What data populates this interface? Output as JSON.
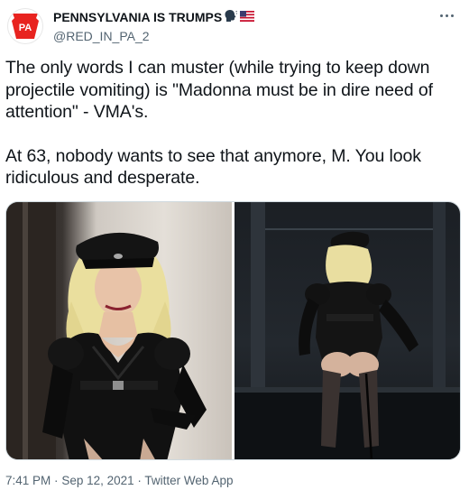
{
  "author": {
    "name": "PENNSYLVANIA IS TRUMPS",
    "handle": "@RED_IN_PA_2",
    "avatar_text": "PA",
    "name_emojis": [
      "speaking-head-icon",
      "us-flag-icon"
    ]
  },
  "tweet": {
    "paragraphs": [
      "The only words I can muster (while trying to keep down projectile vomiting) is \"Madonna must be in dire need of attention\" - VMA's.",
      "At 63, nobody wants to see that anymore, M.  You look ridiculous and desperate."
    ]
  },
  "media": {
    "photos": [
      {
        "name": "photo-performer-front"
      },
      {
        "name": "photo-performer-back"
      }
    ]
  },
  "meta": {
    "time": "7:41 PM",
    "separator": "·",
    "date": "Sep 12, 2021",
    "source": "Twitter Web App"
  },
  "colors": {
    "avatar_red": "#e8231f",
    "secondary_text": "#536471",
    "primary_text": "#0f1419"
  }
}
